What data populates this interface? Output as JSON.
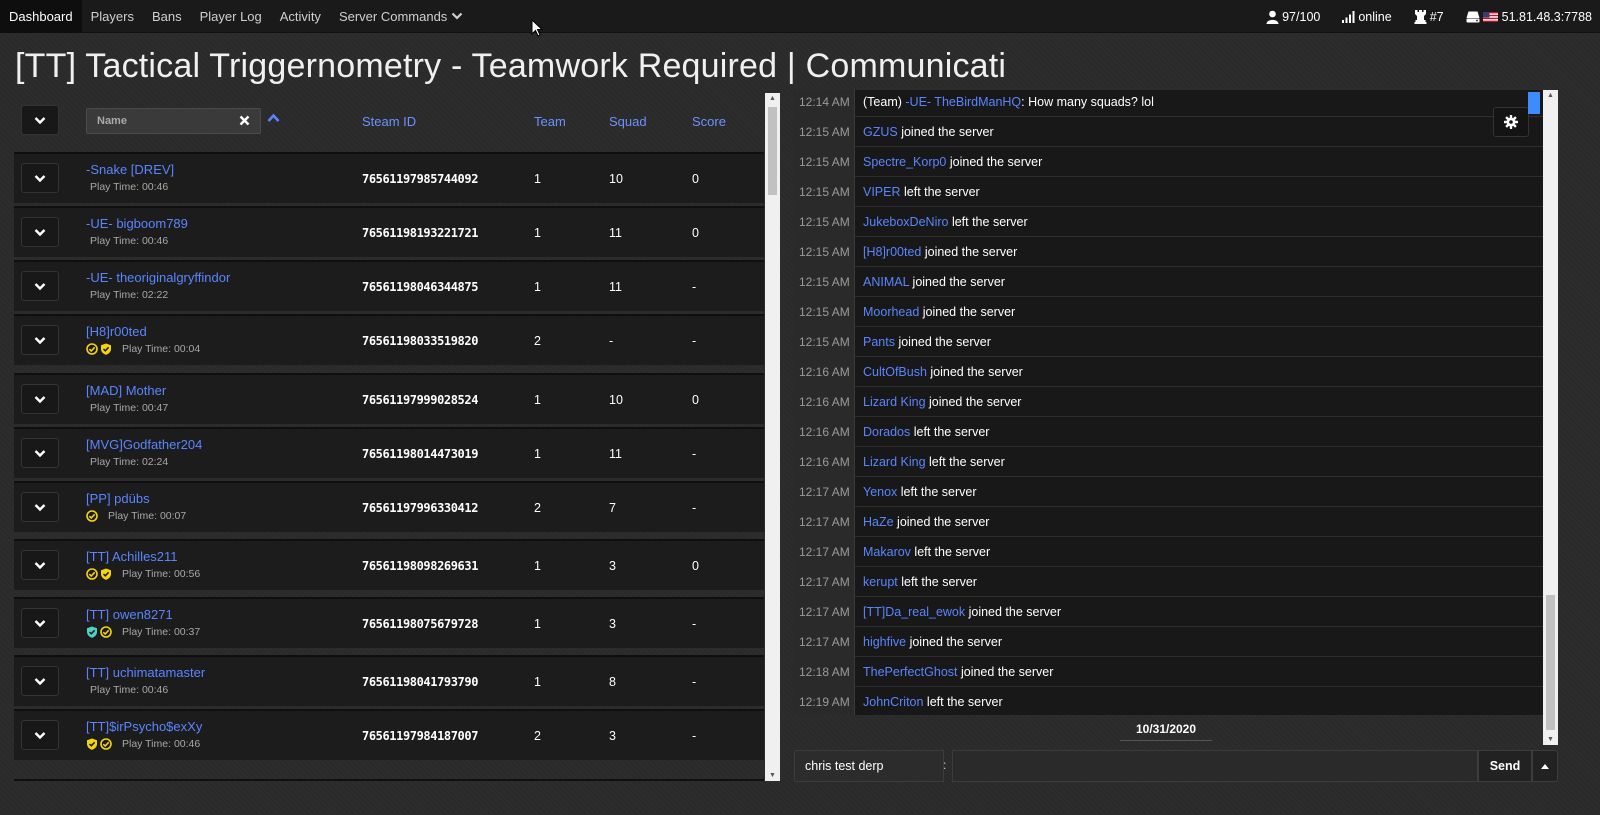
{
  "nav": {
    "items": [
      "Dashboard",
      "Players",
      "Bans",
      "Player Log",
      "Activity",
      "Server Commands"
    ],
    "active_index": 0,
    "stats": {
      "players": "97/100",
      "status": "online",
      "rank": "#7",
      "server_ip": "51.81.48.3:7788"
    }
  },
  "page_title": "[TT] Tactical Triggernometry - Teamwork Required | Communicati",
  "table": {
    "name_filter_label": "Name",
    "columns": [
      "Steam ID",
      "Team",
      "Squad",
      "Score"
    ],
    "play_time_prefix": "Play Time: ",
    "rows": [
      {
        "name": "-Snake [DREV]",
        "play_time": "00:46",
        "badges": [],
        "steam_id": "76561197985744092",
        "team": "1",
        "squad": "10",
        "score": "0"
      },
      {
        "name": "-UE- bigboom789",
        "play_time": "00:46",
        "badges": [],
        "steam_id": "76561198193221721",
        "team": "1",
        "squad": "11",
        "score": "0"
      },
      {
        "name": "-UE- theoriginalgryffindor",
        "play_time": "02:22",
        "badges": [],
        "steam_id": "76561198046344875",
        "team": "1",
        "squad": "11",
        "score": "-"
      },
      {
        "name": "[H8]r00ted",
        "play_time": "00:04",
        "badges": [
          "yellow-check-circle",
          "yellow-shield"
        ],
        "steam_id": "76561198033519820",
        "team": "2",
        "squad": "-",
        "score": "-"
      },
      {
        "name": "[MAD] Mother",
        "play_time": "00:47",
        "badges": [],
        "steam_id": "76561197999028524",
        "team": "1",
        "squad": "10",
        "score": "0"
      },
      {
        "name": "[MVG]Godfather204",
        "play_time": "02:24",
        "badges": [],
        "steam_id": "76561198014473019",
        "team": "1",
        "squad": "11",
        "score": "-"
      },
      {
        "name": "[PP] pdübs",
        "play_time": "00:07",
        "badges": [
          "yellow-check-circle"
        ],
        "steam_id": "76561197996330412",
        "team": "2",
        "squad": "7",
        "score": "-"
      },
      {
        "name": "[TT] Achilles211",
        "play_time": "00:56",
        "badges": [
          "yellow-check-circle",
          "yellow-shield"
        ],
        "steam_id": "76561198098269631",
        "team": "1",
        "squad": "3",
        "score": "0"
      },
      {
        "name": "[TT] owen8271",
        "play_time": "00:37",
        "badges": [
          "teal-shield",
          "yellow-check-circle"
        ],
        "steam_id": "76561198075679728",
        "team": "1",
        "squad": "3",
        "score": "-"
      },
      {
        "name": "[TT] uchimatamaster",
        "play_time": "00:46",
        "badges": [],
        "steam_id": "76561198041793790",
        "team": "1",
        "squad": "8",
        "score": "-"
      },
      {
        "name": "[TT]$irPsycho$exXy",
        "play_time": "00:46",
        "badges": [
          "yellow-shield",
          "yellow-check-circle"
        ],
        "steam_id": "76561197984187007",
        "team": "2",
        "squad": "3",
        "score": "-"
      }
    ]
  },
  "chat": {
    "messages": [
      {
        "time": "12:14 AM",
        "prefix": "(Team) ",
        "who": "-UE- TheBirdManHQ",
        "text": ": How many squads? lol"
      },
      {
        "time": "12:15 AM",
        "prefix": "",
        "who": "GZUS",
        "text": " joined the server"
      },
      {
        "time": "12:15 AM",
        "prefix": "",
        "who": "Spectre_Korp0",
        "text": " joined the server"
      },
      {
        "time": "12:15 AM",
        "prefix": "",
        "who": "VIPER",
        "text": " left the server"
      },
      {
        "time": "12:15 AM",
        "prefix": "",
        "who": "JukeboxDeNiro",
        "text": " left the server"
      },
      {
        "time": "12:15 AM",
        "prefix": "",
        "who": "[H8]r00ted",
        "text": " joined the server"
      },
      {
        "time": "12:15 AM",
        "prefix": "",
        "who": "ANIMAL",
        "text": " joined the server"
      },
      {
        "time": "12:15 AM",
        "prefix": "",
        "who": "Moorhead",
        "text": " joined the server"
      },
      {
        "time": "12:15 AM",
        "prefix": "",
        "who": "Pants",
        "text": " joined the server"
      },
      {
        "time": "12:16 AM",
        "prefix": "",
        "who": "CultOfBush",
        "text": " joined the server"
      },
      {
        "time": "12:16 AM",
        "prefix": "",
        "who": "Lizard King",
        "text": " joined the server"
      },
      {
        "time": "12:16 AM",
        "prefix": "",
        "who": "Dorados",
        "text": " left the server"
      },
      {
        "time": "12:16 AM",
        "prefix": "",
        "who": "Lizard King",
        "text": " left the server"
      },
      {
        "time": "12:17 AM",
        "prefix": "",
        "who": "Yenox",
        "text": " left the server"
      },
      {
        "time": "12:17 AM",
        "prefix": "",
        "who": "HaZe",
        "text": " joined the server"
      },
      {
        "time": "12:17 AM",
        "prefix": "",
        "who": "Makarov",
        "text": " left the server"
      },
      {
        "time": "12:17 AM",
        "prefix": "",
        "who": "kerupt",
        "text": " left the server"
      },
      {
        "time": "12:17 AM",
        "prefix": "",
        "who": "[TT]Da_real_ewok",
        "text": " joined the server"
      },
      {
        "time": "12:17 AM",
        "prefix": "",
        "who": "highfive",
        "text": " joined the server"
      },
      {
        "time": "12:18 AM",
        "prefix": "",
        "who": "ThePerfectGhost",
        "text": " joined the server"
      },
      {
        "time": "12:19 AM",
        "prefix": "",
        "who": "JohnCriton",
        "text": " left the server"
      }
    ],
    "date": "10/31/2020",
    "name_value": "chris test derp",
    "separator": ":",
    "message_value": "",
    "send_label": "Send"
  },
  "colors": {
    "link": "#5a85ff",
    "badge_yellow": "#f5d40f",
    "badge_teal": "#4fd1c5",
    "scroll_marker": "#3d8bfd"
  }
}
